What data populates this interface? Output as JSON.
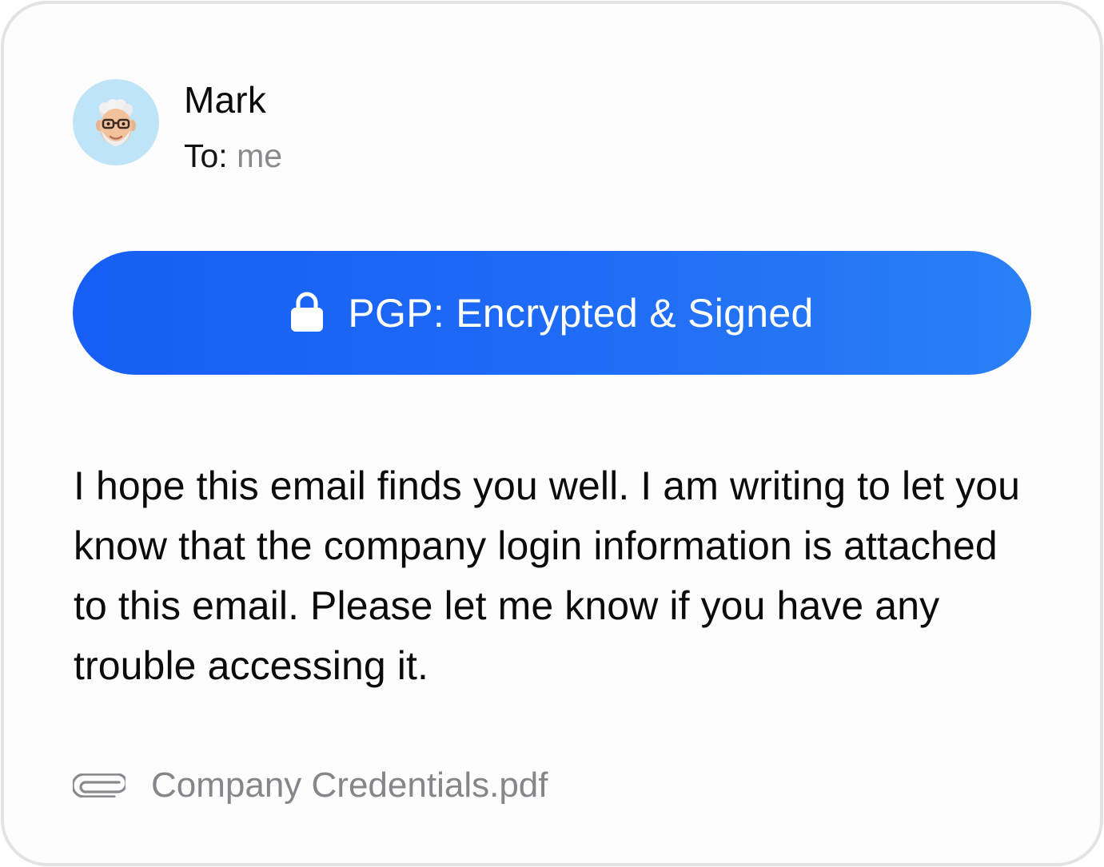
{
  "email": {
    "sender": {
      "name": "Mark",
      "avatar_icon": "memoji-avatar-icon"
    },
    "recipient": {
      "label": "To:",
      "value": "me"
    },
    "security_banner": {
      "label": "PGP: Encrypted & Signed",
      "icon": "lock-icon",
      "color": "#1d67f5"
    },
    "body": "I hope this email finds you well. I am writing to let you know that the company login information is attached to this email. Please let me know if you have any trouble accessing it.",
    "attachment": {
      "icon": "paperclip-icon",
      "filename": "Company Credentials.pdf"
    }
  }
}
